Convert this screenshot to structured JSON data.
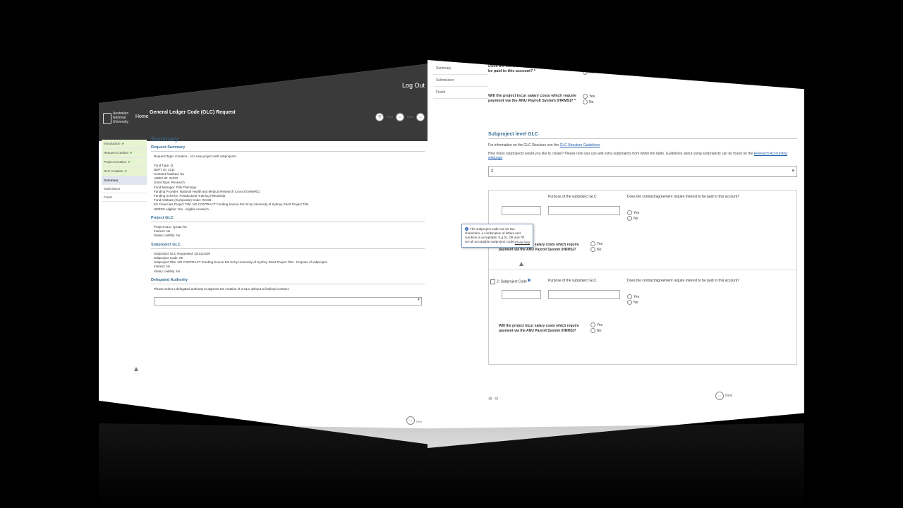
{
  "left": {
    "header": {
      "logout": "Log Out",
      "university": "Australian National University",
      "home": "Home",
      "title": "General Ledger Code (GLC) Request"
    },
    "toolbar": {
      "save": "Save",
      "back": "Back",
      "next": "Next"
    },
    "sidebar": [
      {
        "label": "Introduction"
      },
      {
        "label": "Request Creation"
      },
      {
        "label": "Project Creation"
      },
      {
        "label": "GLC Creation"
      },
      {
        "label": "Summary"
      },
      {
        "label": "Submission"
      },
      {
        "label": "Finish"
      }
    ],
    "summary": {
      "title": "Summary",
      "request_summary": "Request Summary",
      "request_type": "Request Type: Creation - of a new project with subprojects",
      "fund_type": "Fund Type: Q",
      "deptid": "DEPT ID: 2111",
      "contract_finalised": "Contract finalised: No",
      "aries_id": "ARIES ID: 22222",
      "grant_type": "Grant Type: Research",
      "fund_manager": "Fund Manager: Pink Flamingo",
      "funding_provider": "Funding Provider: National Health and Medical Research Council (NHMRC)",
      "funding_scheme": "Funding Scheme: Postdoctoral Training Fellowship",
      "fund_attribute": "Fund Attribute (Composite) Code: GCCB",
      "es_title": "ES Financials Project Title: NO CONTRACT Funding Source Est lst by University of Sydney Short Project Title",
      "herdc": "HERDC eligible: Yes - eligible research",
      "project_glc": "Project GLC",
      "project_glc_value": "Project GLC: Q2111?xx",
      "interest": "Interest: No",
      "salary_liability": "Salary Liability: No",
      "subproject_glc": "Subproject GLC",
      "subproject_requested": "Subproject GLC Requested: Q2111xx09",
      "subproject_code": "Subproject Code: 09",
      "subproject_title": "Subproject Title: NO CONTRACT Funding Source Est lst by University of Sydney Short Project Title - Purpose of subproject",
      "sub_interest": "Interest: No",
      "sub_salary": "Salary Liability: No",
      "delegated": "Delegated Authority",
      "delegated_text": "Please select a delegated authority to approve the creation of a GLC without a finalised contract."
    },
    "next_btn": "Next"
  },
  "right": {
    "sidebar": [
      {
        "label": "Summary"
      },
      {
        "label": "Submission"
      },
      {
        "label": "Finish"
      }
    ],
    "q_interest": "Does the contract/agreement require interest to be paid to this account? *",
    "q_salary": "Will the project incur salary costs which require payment via the ANU Payroll System (HRMS)? *",
    "yes": "Yes",
    "no": "No",
    "subproject_level": "Subproject level GLC",
    "info_prefix": "For information on the GLC Structure see the",
    "info_link": "GLC Structure Guidelines",
    "how_many": "How many subprojects would you like to create? Please note you can add extra subprojects from within the table. Guidelines about using subprojects can be found on the",
    "how_many_link": "Research Accounting webpage",
    "count_value": "2",
    "tooltip": "The subproject code can be two characters, a combination of letters and numbers is acceptable. E.g 01, 0R and 7R are all acceptable subproject codes.",
    "tooltip_close": "Close help",
    "col_code": "Subproject Code",
    "col_purpose": "Purpose of the subproject GLC",
    "col_interest": "Does the contract/agreement require interest to be paid to this account?",
    "row_salary": "Will the project incur salary costs which require payment via the ANU Payroll System (HRMS)?",
    "row2_index": "2",
    "next": "Next"
  }
}
